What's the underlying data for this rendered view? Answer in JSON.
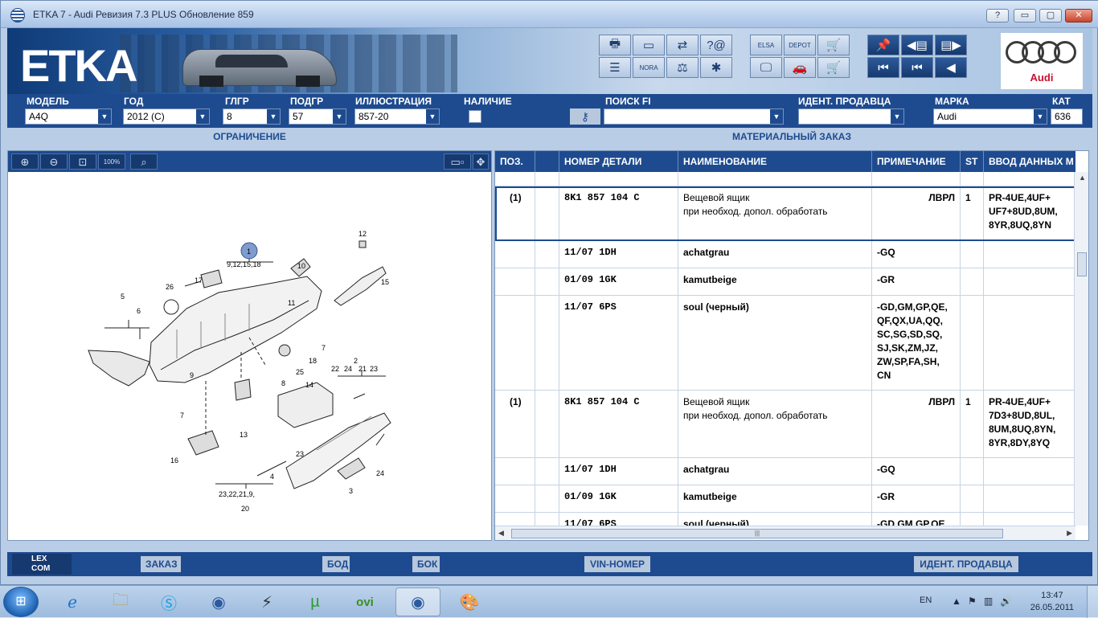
{
  "window": {
    "title": "ETKA 7 - Audi Ревизия 7.3 PLUS Обновление 859",
    "help_btn": "?",
    "min_btn": "▭",
    "max_btn": "▢",
    "close_btn": "✕"
  },
  "banner": {
    "logo": "ETKA",
    "brand": "Audi",
    "toolbar_group1": [
      "printer-icon",
      "screen-icon",
      "handshake-icon",
      "help-at-icon",
      "list-icon",
      "nora-icon",
      "balance-icon",
      "wheel-icon"
    ],
    "toolbar_group1_labels": [
      "",
      "",
      "",
      "",
      "",
      "NORA",
      "",
      ""
    ],
    "toolbar_group2": [
      "elsa-icon",
      "depot-icon",
      "cart-icon",
      "monitor-icon",
      "car-icon",
      "cart-full-icon"
    ],
    "toolbar_group2_labels": [
      "ELSA",
      "DEPOT",
      "",
      "",
      "",
      ""
    ],
    "toolbar_group3": [
      "pin-icon",
      "prev-page-icon",
      "next-page-icon",
      "first-icon",
      "prev-icon",
      "back-icon"
    ]
  },
  "filters": {
    "model_label": "МОДЕЛЬ",
    "model_value": "A4Q",
    "year_label": "ГОД",
    "year_value": "2012 (C)",
    "mgroup_label": "ГЛГР",
    "mgroup_value": "8",
    "sgroup_label": "ПОДГР",
    "sgroup_value": "57",
    "illus_label": "ИЛЛЮСТРАЦИЯ",
    "illus_value": "857-20",
    "avail_label": "НАЛИЧИЕ",
    "search_label": "ПОИСК FI",
    "search_value": "",
    "dealer_label": "ИДЕНТ. ПРОДАВЦА",
    "dealer_value": "",
    "brand_label": "МАРКА",
    "brand_value": "Audi",
    "cat_label": "КАТ",
    "cat_value": "636"
  },
  "sections": {
    "left": "ОГРАНИЧЕНИЕ",
    "right": "МАТЕРИАЛЬНЫЙ ЗАКАЗ"
  },
  "diagram_tools": [
    "zoom-in-icon",
    "zoom-out-icon",
    "zoom-fit-icon",
    "zoom-100-icon",
    "magnifier-icon"
  ],
  "diagram_labels": [
    "1",
    "9,12,15,18",
    "2",
    "22",
    "24",
    "21",
    "23",
    "3",
    "4",
    "5",
    "6",
    "7",
    "7",
    "8",
    "9",
    "10",
    "11",
    "12",
    "13",
    "14",
    "15",
    "16",
    "17",
    "18",
    "20",
    "23,22,21,9,",
    "23",
    "24",
    "25",
    "26"
  ],
  "table": {
    "columns": [
      "ПОЗ.",
      "",
      "НОМЕР ДЕТАЛИ",
      "НАИМЕНОВАНИЕ",
      "ПРИМЕЧАНИЕ",
      "ST",
      "ВВОД ДАННЫХ М"
    ],
    "rows": [
      {
        "pos": "(1)",
        "num": "8K1 857 104 C",
        "name": "Вещевой ящик\nпри необход. допол. обработать",
        "note": "ЛВРЛ",
        "st": "1",
        "data": "PR-4UE,4UF+\nUF7+8UD,8UM,\n8YR,8UQ,8YN"
      },
      {
        "pos": "",
        "num": "11/07        1DH",
        "name": "achatgrau",
        "note": "-GQ",
        "st": "",
        "data": ""
      },
      {
        "pos": "",
        "num": "01/09        1GK",
        "name": "kamutbeige",
        "note": "-GR",
        "st": "",
        "data": ""
      },
      {
        "pos": "",
        "num": "11/07        6PS",
        "name": "soul (черный)",
        "note": "-GD,GM,GP,QE,\nQF,QX,UA,QQ,\nSC,SG,SD,SQ,\nSJ,SK,ZM,JZ,\nZW,SP,FA,SH,\nCN",
        "st": "",
        "data": ""
      },
      {
        "pos": "(1)",
        "num": "8K1 857 104 C",
        "name": "Вещевой ящик\nпри необход. допол. обработать",
        "note": "ЛВРЛ",
        "st": "1",
        "data": "PR-4UE,4UF+\n7D3+8UD,8UL,\n8UM,8UQ,8YN,\n8YR,8DY,8YQ"
      },
      {
        "pos": "",
        "num": "11/07        1DH",
        "name": "achatgrau",
        "note": "-GQ",
        "st": "",
        "data": ""
      },
      {
        "pos": "",
        "num": "01/09        1GK",
        "name": "kamutbeige",
        "note": "-GR",
        "st": "",
        "data": ""
      },
      {
        "pos": "",
        "num": "11/07        6PS",
        "name": "soul (черный)",
        "note": "-GD,GM,GP,QE,",
        "st": "",
        "data": ""
      }
    ]
  },
  "bottom": {
    "lexcom": "LEX\nCOM",
    "order": "ЗАКАЗ",
    "bod": "БОД",
    "bok": "БОК",
    "vin": "VIN-НОМЕР",
    "dealer": "ИДЕНТ. ПРОДАВЦА"
  },
  "taskbar": {
    "apps": [
      "windows-start-icon",
      "internet-explorer-icon",
      "file-explorer-icon",
      "skype-icon",
      "etka-icon",
      "winamp-icon",
      "utorrent-icon",
      "ovi-icon",
      "etka-active-icon",
      "paint-icon"
    ],
    "lang": "EN",
    "time": "13:47",
    "date": "26.05.2011"
  }
}
